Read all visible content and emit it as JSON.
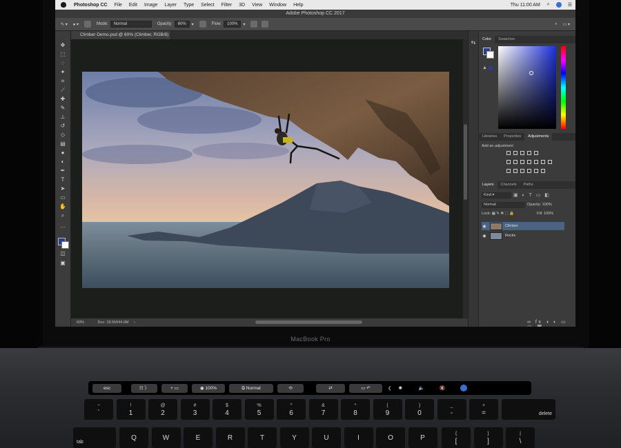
{
  "menubar": {
    "app_name": "Photoshop CC",
    "menus": [
      "File",
      "Edit",
      "Image",
      "Layer",
      "Type",
      "Select",
      "Filter",
      "3D",
      "View",
      "Window",
      "Help"
    ],
    "clock": "Thu 11:00 AM"
  },
  "window": {
    "title": "Adobe Photoshop CC 2017"
  },
  "options_bar": {
    "mode_label": "Mode:",
    "mode_value": "Normal",
    "opacity_label": "Opacity:",
    "opacity_value": "60%",
    "flow_label": "Flow:",
    "flow_value": "100%"
  },
  "document": {
    "tab_title": "Climber Demo.psd @ 60% (Climber, RGB/8) *",
    "zoom": "60%",
    "doc_size": "Doc: 18.5M/44.0M"
  },
  "panels": {
    "color_tabs": [
      "Color",
      "Swatches"
    ],
    "adjust_tabs": [
      "Libraries",
      "Properties",
      "Adjustments"
    ],
    "add_adjustment": "Add an adjustment",
    "layers_tabs": [
      "Layers",
      "Channels",
      "Paths"
    ],
    "kind_filter": "Kind",
    "blend_mode": "Normal",
    "opacity_label": "Opacity:",
    "opacity_value": "100%",
    "lock_label": "Lock:",
    "fill_label": "Fill:",
    "fill_value": "100%",
    "layers": [
      {
        "name": "Climber",
        "selected": true
      },
      {
        "name": "Rocks",
        "selected": false
      }
    ]
  },
  "colors": {
    "foreground": "#2a3d8f",
    "background": "#ffffff",
    "accent_selection": "#4b6383"
  },
  "laptop": {
    "label": "MacBook Pro"
  },
  "touchbar": {
    "esc": "esc",
    "zoom": "100%",
    "blend": "Normal"
  },
  "keyboard": {
    "number_row": [
      {
        "top": "~",
        "bottom": "`"
      },
      {
        "top": "!",
        "bottom": "1"
      },
      {
        "top": "@",
        "bottom": "2"
      },
      {
        "top": "#",
        "bottom": "3"
      },
      {
        "top": "$",
        "bottom": "4"
      },
      {
        "top": "%",
        "bottom": "5"
      },
      {
        "top": "^",
        "bottom": "6"
      },
      {
        "top": "&",
        "bottom": "7"
      },
      {
        "top": "*",
        "bottom": "8"
      },
      {
        "top": "(",
        "bottom": "9"
      },
      {
        "top": ")",
        "bottom": "0"
      },
      {
        "top": "_",
        "bottom": "-"
      },
      {
        "top": "+",
        "bottom": "="
      }
    ],
    "delete": "delete",
    "tab": "tab",
    "letter_row": [
      "Q",
      "W",
      "E",
      "R",
      "T",
      "Y",
      "U",
      "I",
      "O",
      "P"
    ],
    "bracket_row": [
      {
        "top": "{",
        "bottom": "["
      },
      {
        "top": "}",
        "bottom": "]"
      },
      {
        "top": "|",
        "bottom": "\\"
      }
    ]
  }
}
